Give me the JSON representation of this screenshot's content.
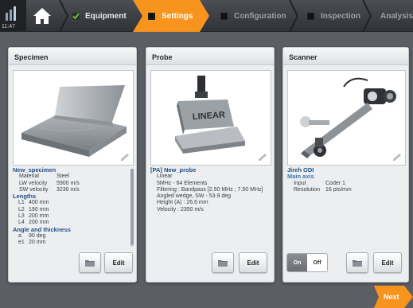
{
  "status": {
    "time": "11:47"
  },
  "nav": {
    "home_icon": "home-icon",
    "steps": [
      {
        "label": "Equipment",
        "state": "done"
      },
      {
        "label": "Settings",
        "state": "active"
      },
      {
        "label": "Configuration",
        "state": "pending"
      },
      {
        "label": "Inspection",
        "state": "pending"
      },
      {
        "label": "Analysis",
        "state": "pending"
      }
    ]
  },
  "specimen": {
    "header": "Specimen",
    "name": "New_specimen",
    "props": [
      {
        "k": "Material",
        "v": "Steel"
      },
      {
        "k": "LW velocity",
        "v": "5900 m/s"
      },
      {
        "k": "SW velocity",
        "v": "3230 m/s"
      }
    ],
    "lengths_title": "Lengths",
    "lengths": [
      {
        "k": "L1",
        "v": "400 mm"
      },
      {
        "k": "L2",
        "v": "190 mm"
      },
      {
        "k": "L3",
        "v": "200 mm"
      },
      {
        "k": "L4",
        "v": "200 mm"
      }
    ],
    "angle_title": "Angle and thickness",
    "angles": [
      {
        "k": "a",
        "v": "90 deg"
      },
      {
        "k": "e1",
        "v": "20 mm"
      }
    ],
    "edit_label": "Edit"
  },
  "probe": {
    "header": "Probe",
    "name": "[PA] New_probe",
    "lines": [
      "Linear",
      "5MHz - 64 Elements",
      "Filtering : Bandpass [2.50 MHz ; 7.50 MHz]",
      "Angled wedge, SW - 53.9 deg",
      "Height (A) : 26.6 mm",
      "Velocity : 2350 m/s"
    ],
    "probe_text": "LINEAR",
    "edit_label": "Edit"
  },
  "scanner": {
    "header": "Scanner",
    "name": "Jireh ODI",
    "axis": "Main axis",
    "props": [
      {
        "k": "Input",
        "v": "Coder 1"
      },
      {
        "k": "Resolution",
        "v": "16 pts/mm"
      }
    ],
    "on_label": "On",
    "off_label": "Off",
    "edit_label": "Edit"
  },
  "footer": {
    "next_label": "Next"
  },
  "colors": {
    "accent": "#f7941d",
    "done": "#6bbf3a",
    "title_blue": "#1f4f86"
  }
}
